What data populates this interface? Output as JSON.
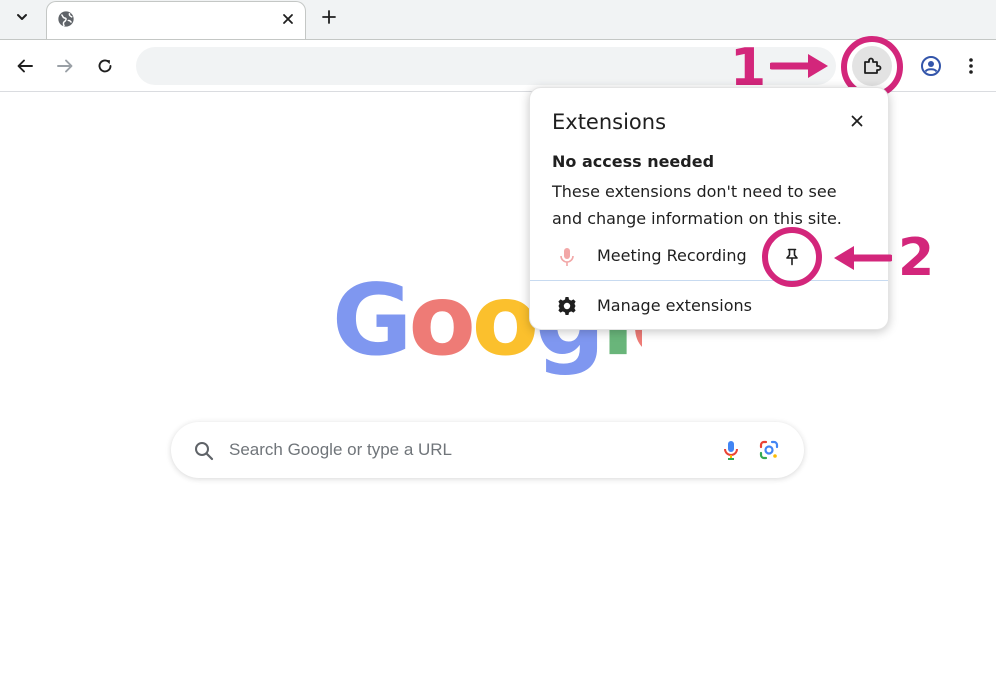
{
  "browser": {
    "tab": {
      "title": ""
    },
    "omnibox": {
      "value": ""
    }
  },
  "popup": {
    "title": "Extensions",
    "section_heading": "No access needed",
    "section_description": "These extensions don't need to see and change information on this site.",
    "extensions": [
      {
        "name": "Meeting Recording",
        "icon": "microphone-icon"
      }
    ],
    "manage_label": "Manage extensions"
  },
  "search": {
    "placeholder": "Search Google or type a URL"
  },
  "annotations": {
    "step1": "1",
    "step2": "2",
    "color": "#d3267b"
  },
  "logo": {
    "text": "Google",
    "colors": [
      "#7f97f0",
      "#ee7b76",
      "#fbc02d",
      "#7f97f0",
      "#69b57a",
      "#ee7b76"
    ]
  }
}
